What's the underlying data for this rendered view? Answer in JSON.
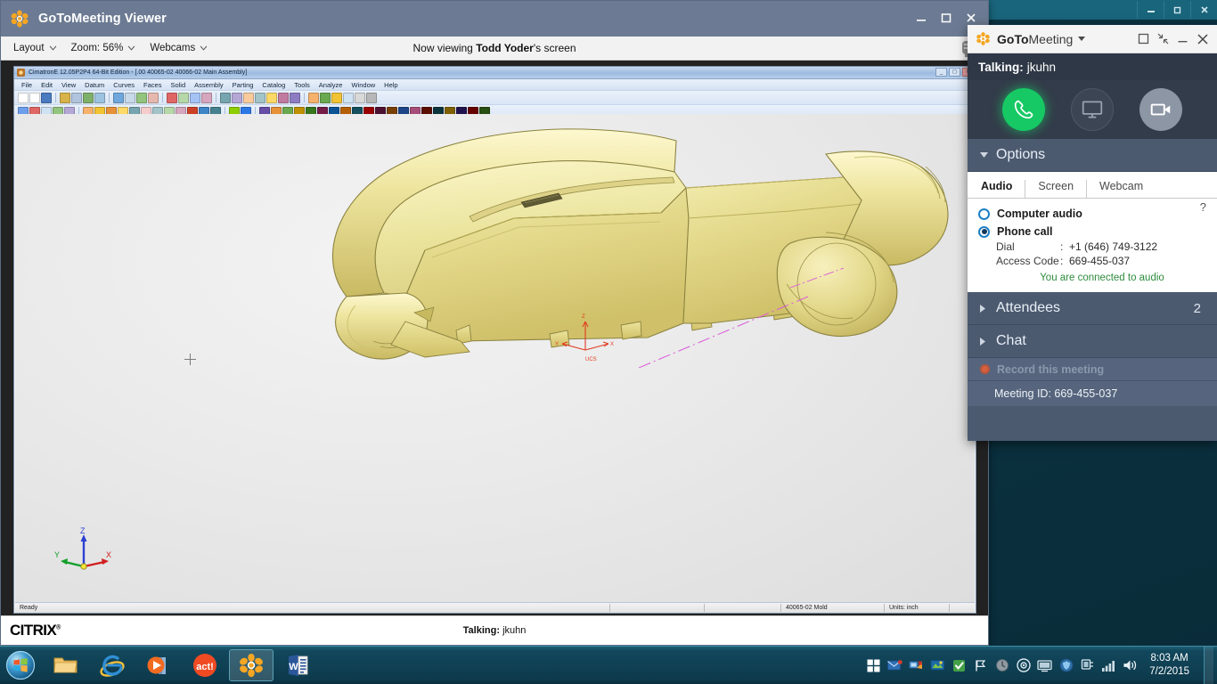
{
  "desktop": {
    "outer_window_controls": [
      "minimize",
      "restore",
      "close"
    ]
  },
  "viewer": {
    "title": "GoToMeeting Viewer",
    "logo_icon": "gotomeeting-flower-icon",
    "window_controls": {
      "minimize": "minimize-icon",
      "maximize": "maximize-icon",
      "close": "close-icon"
    },
    "toolbar": {
      "layout_label": "Layout",
      "zoom_label": "Zoom: 56%",
      "webcams_label": "Webcams",
      "camera_icon": "webcam-icon"
    },
    "now_viewing_prefix": "Now viewing ",
    "now_viewing_presenter": "Todd Yoder",
    "now_viewing_suffix": "'s screen"
  },
  "cad": {
    "title": "CimatronE 12.05P2P4  64-Bit Edition - [.00  40065-02 40066-02 Main Assembly]",
    "window_buttons": [
      "minimize",
      "restore",
      "close"
    ],
    "menus": [
      "File",
      "Edit",
      "View",
      "Datum",
      "Curves",
      "Faces",
      "Solid",
      "Assembly",
      "Parting",
      "Catalog",
      "Tools",
      "Analyze",
      "Window",
      "Help"
    ],
    "statusbar": {
      "ready": "Ready",
      "document": "40065-02 Mold",
      "units": "Units: inch"
    },
    "viewport": {
      "triad_labels": {
        "z": "Z",
        "y": "Y",
        "x": "X"
      },
      "model_triad_labels": {
        "z": "Z",
        "y": "Y",
        "x": "X"
      },
      "model_color": "#e6dd8f",
      "crosshair_icon": "crosshair-cursor-icon"
    }
  },
  "citrix": {
    "logo": "CITRIX",
    "logo_mark": "®",
    "talking_prefix": "Talking: ",
    "talking_name": "jkuhn"
  },
  "gtm": {
    "brand_bold": "GoTo",
    "brand_light": "Meeting",
    "brand_caret_icon": "chevron-down-icon",
    "logo_icon": "gotomeeting-flower-icon",
    "header_buttons": {
      "restore": "restore-icon",
      "collapse": "collapse-icon",
      "minimize": "minimize-icon",
      "close": "close-icon"
    },
    "talking_label": "Talking:",
    "talking_name": "jkuhn",
    "actions": {
      "audio": "phone-icon",
      "screen": "monitor-icon",
      "webcam": "video-camera-icon"
    },
    "options": {
      "label": "Options",
      "expanded": true,
      "caret_icon": "caret-down-icon"
    },
    "tabs": [
      {
        "label": "Audio",
        "active": true
      },
      {
        "label": "Screen",
        "active": false
      },
      {
        "label": "Webcam",
        "active": false
      }
    ],
    "help_icon": "?",
    "audio": {
      "computer_audio_label": "Computer audio",
      "computer_audio_selected": false,
      "phone_call_label": "Phone call",
      "phone_call_selected": true,
      "dial_key": "Dial",
      "dial_sep": ":",
      "dial_value": "+1 (646) 749-3122",
      "access_key": "Access Code",
      "access_sep": ":",
      "access_value": "669-455-037",
      "status": "You are connected to audio",
      "status_color": "#2e8b3d"
    },
    "attendees": {
      "label": "Attendees",
      "count": "2",
      "caret_icon": "caret-right-icon"
    },
    "chat": {
      "label": "Chat",
      "caret_icon": "caret-right-icon"
    },
    "record": {
      "label": "Record this meeting",
      "icon": "record-dot-icon"
    },
    "meeting_id": "Meeting ID: 669-455-037"
  },
  "taskbar": {
    "start_icon": "windows-start-orb-icon",
    "apps": [
      {
        "name": "file-explorer-icon",
        "open": false
      },
      {
        "name": "internet-explorer-icon",
        "open": false
      },
      {
        "name": "media-player-icon",
        "open": false
      },
      {
        "name": "act-crm-icon",
        "open": false
      },
      {
        "name": "gotomeeting-icon",
        "open": true
      },
      {
        "name": "microsoft-word-icon",
        "open": false
      }
    ],
    "tray_icons": [
      "show-hidden-icons",
      "mail-icon",
      "network-alert-icon",
      "display-icon",
      "security-check-icon",
      "flag-icon",
      "update-icon",
      "disc-icon",
      "monitor-icon",
      "shield-icon",
      "plug-icon",
      "signal-icon",
      "volume-icon"
    ],
    "clock_time": "8:03 AM",
    "clock_date": "7/2/2015"
  }
}
